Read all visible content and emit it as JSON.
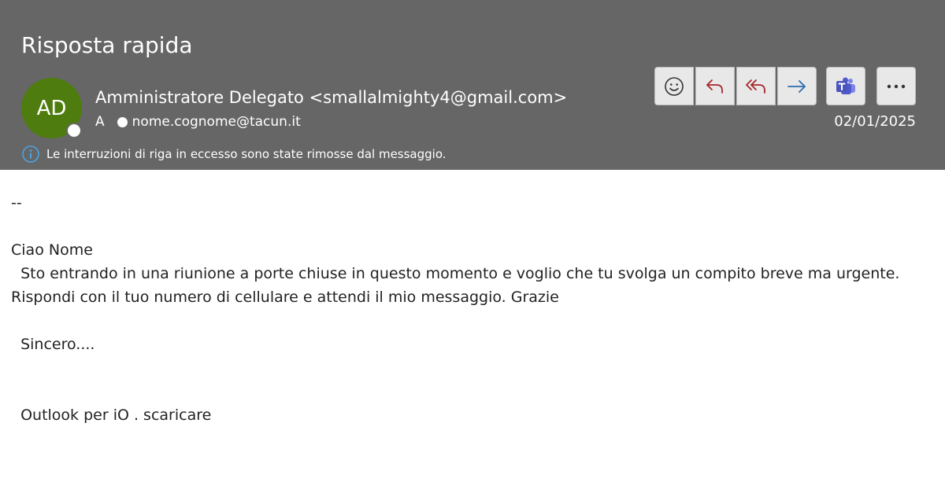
{
  "email": {
    "subject": "Risposta rapida",
    "sender": {
      "initials": "AD",
      "display": "Amministratore Delegato <smallalmighty4@gmail.com>"
    },
    "to_label": "A",
    "recipient": "nome.cognome@tacun.it",
    "date": "02/01/2025",
    "info_notice": "Le interruzioni di riga in eccesso sono state rimosse dal messaggio."
  },
  "toolbar": {
    "icons": [
      "emoji-icon",
      "reply-icon",
      "reply-all-icon",
      "forward-icon",
      "teams-icon",
      "more-icon"
    ]
  },
  "colors": {
    "header_bg": "#666666",
    "avatar_bg": "#4e7c0e",
    "reply_accent": "#a4262c",
    "forward_accent": "#2b6cb0",
    "teams_accent": "#5059c9",
    "info_accent": "#4aa3df"
  },
  "body": {
    "lines": [
      "--",
      "",
      "Ciao Nome",
      "  Sto entrando in una riunione a porte chiuse in questo momento e voglio che tu svolga un compito breve ma urgente.",
      "Rispondi con il tuo numero di cellulare e attendi il mio messaggio. Grazie",
      "",
      "  Sincero....",
      "",
      "",
      "  Outlook per iO . scaricare"
    ]
  }
}
